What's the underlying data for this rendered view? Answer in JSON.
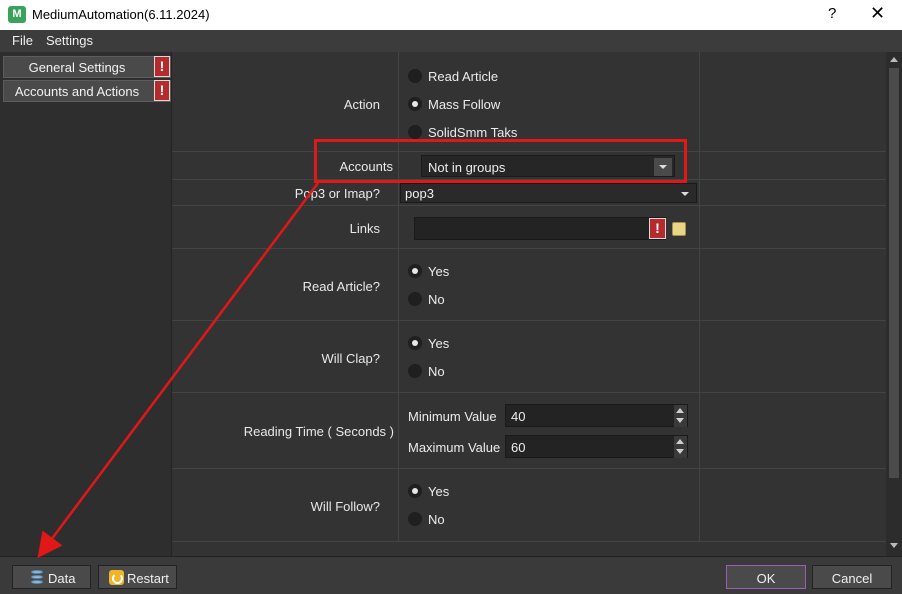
{
  "window": {
    "title": "MediumAutomation(6.11.2024)",
    "help": "?",
    "close": "✕"
  },
  "menu": {
    "file": "File",
    "settings": "Settings"
  },
  "sidebar": {
    "items": [
      {
        "label": "General Settings",
        "warn": "!"
      },
      {
        "label": "Accounts and Actions",
        "warn": "!"
      }
    ]
  },
  "form": {
    "action": {
      "label": "Action",
      "options": [
        "Read Article",
        "Mass Follow",
        "SolidSmm Taks"
      ],
      "selected": "Mass Follow"
    },
    "accounts": {
      "label": "Accounts",
      "value": "Not in groups"
    },
    "pop3": {
      "label": "Pop3 or Imap?",
      "value": "pop3"
    },
    "links": {
      "label": "Links",
      "value": "",
      "warn": "!"
    },
    "read_article": {
      "label": "Read Article?",
      "options": [
        "Yes",
        "No"
      ],
      "selected": "Yes"
    },
    "will_clap": {
      "label": "Will Clap?",
      "options": [
        "Yes",
        "No"
      ],
      "selected": "Yes"
    },
    "reading_time": {
      "label": "Reading Time ( Seconds )",
      "min_label": "Minimum Value",
      "min_value": "40",
      "max_label": "Maximum Value",
      "max_value": "60"
    },
    "will_follow": {
      "label": "Will Follow?",
      "options": [
        "Yes",
        "No"
      ],
      "selected": "Yes"
    }
  },
  "buttons": {
    "data": "Data",
    "restart": "Restart",
    "ok": "OK",
    "cancel": "Cancel"
  },
  "colors": {
    "annotation": "#e01818",
    "ok_border": "#9b5db8",
    "warn": "#b52b2b"
  }
}
